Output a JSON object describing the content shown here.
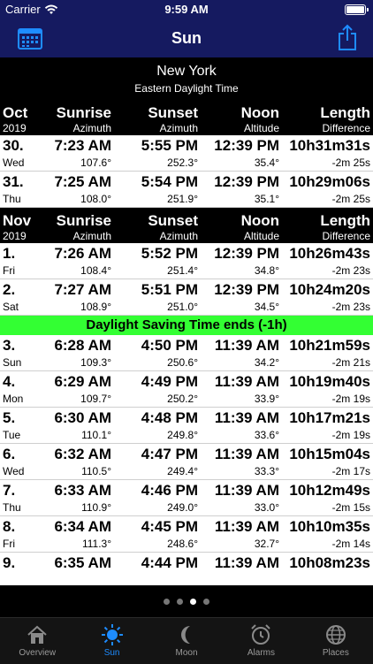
{
  "status": {
    "carrier": "Carrier",
    "time": "9:59 AM"
  },
  "nav": {
    "title": "Sun",
    "left_icon": "calendar-icon",
    "right_icon": "share-icon"
  },
  "location": {
    "city": "New York",
    "timezone": "Eastern Daylight Time"
  },
  "columns": {
    "sunrise": "Sunrise",
    "sunrise_sub": "Azimuth",
    "sunset": "Sunset",
    "sunset_sub": "Azimuth",
    "noon": "Noon",
    "noon_sub": "Altitude",
    "length": "Length",
    "length_sub": "Difference"
  },
  "oct": {
    "month": "Oct",
    "year": "2019",
    "rows": [
      {
        "day": "30.",
        "dow": "Wed",
        "sunrise": "7:23 AM",
        "sunrise_az": "107.6°",
        "sunset": "5:55 PM",
        "sunset_az": "252.3°",
        "noon": "12:39 PM",
        "noon_alt": "35.4°",
        "length": "10h31m31s",
        "diff": "-2m 25s"
      },
      {
        "day": "31.",
        "dow": "Thu",
        "sunrise": "7:25 AM",
        "sunrise_az": "108.0°",
        "sunset": "5:54 PM",
        "sunset_az": "251.9°",
        "noon": "12:39 PM",
        "noon_alt": "35.1°",
        "length": "10h29m06s",
        "diff": "-2m 25s"
      }
    ]
  },
  "nov": {
    "month": "Nov",
    "year": "2019",
    "rows_before": [
      {
        "day": "1.",
        "dow": "Fri",
        "sunrise": "7:26 AM",
        "sunrise_az": "108.4°",
        "sunset": "5:52 PM",
        "sunset_az": "251.4°",
        "noon": "12:39 PM",
        "noon_alt": "34.8°",
        "length": "10h26m43s",
        "diff": "-2m 23s"
      },
      {
        "day": "2.",
        "dow": "Sat",
        "sunrise": "7:27 AM",
        "sunrise_az": "108.9°",
        "sunset": "5:51 PM",
        "sunset_az": "251.0°",
        "noon": "12:39 PM",
        "noon_alt": "34.5°",
        "length": "10h24m20s",
        "diff": "-2m 23s"
      }
    ],
    "dst_notice": "Daylight Saving Time ends (-1h)",
    "rows_after": [
      {
        "day": "3.",
        "dow": "Sun",
        "sunrise": "6:28 AM",
        "sunrise_az": "109.3°",
        "sunset": "4:50 PM",
        "sunset_az": "250.6°",
        "noon": "11:39 AM",
        "noon_alt": "34.2°",
        "length": "10h21m59s",
        "diff": "-2m 21s"
      },
      {
        "day": "4.",
        "dow": "Mon",
        "sunrise": "6:29 AM",
        "sunrise_az": "109.7°",
        "sunset": "4:49 PM",
        "sunset_az": "250.2°",
        "noon": "11:39 AM",
        "noon_alt": "33.9°",
        "length": "10h19m40s",
        "diff": "-2m 19s"
      },
      {
        "day": "5.",
        "dow": "Tue",
        "sunrise": "6:30 AM",
        "sunrise_az": "110.1°",
        "sunset": "4:48 PM",
        "sunset_az": "249.8°",
        "noon": "11:39 AM",
        "noon_alt": "33.6°",
        "length": "10h17m21s",
        "diff": "-2m 19s"
      },
      {
        "day": "6.",
        "dow": "Wed",
        "sunrise": "6:32 AM",
        "sunrise_az": "110.5°",
        "sunset": "4:47 PM",
        "sunset_az": "249.4°",
        "noon": "11:39 AM",
        "noon_alt": "33.3°",
        "length": "10h15m04s",
        "diff": "-2m 17s"
      },
      {
        "day": "7.",
        "dow": "Thu",
        "sunrise": "6:33 AM",
        "sunrise_az": "110.9°",
        "sunset": "4:46 PM",
        "sunset_az": "249.0°",
        "noon": "11:39 AM",
        "noon_alt": "33.0°",
        "length": "10h12m49s",
        "diff": "-2m 15s"
      },
      {
        "day": "8.",
        "dow": "Fri",
        "sunrise": "6:34 AM",
        "sunrise_az": "111.3°",
        "sunset": "4:45 PM",
        "sunset_az": "248.6°",
        "noon": "11:39 AM",
        "noon_alt": "32.7°",
        "length": "10h10m35s",
        "diff": "-2m 14s"
      },
      {
        "day": "9.",
        "dow": "",
        "sunrise": "6:35 AM",
        "sunrise_az": "",
        "sunset": "4:44 PM",
        "sunset_az": "",
        "noon": "11:39 AM",
        "noon_alt": "",
        "length": "10h08m23s",
        "diff": ""
      }
    ]
  },
  "pager": {
    "count": 4,
    "active": 2
  },
  "tabs": [
    {
      "label": "Overview",
      "icon": "house-icon"
    },
    {
      "label": "Sun",
      "icon": "sun-icon"
    },
    {
      "label": "Moon",
      "icon": "moon-icon"
    },
    {
      "label": "Alarms",
      "icon": "alarm-clock-icon"
    },
    {
      "label": "Places",
      "icon": "globe-icon"
    }
  ],
  "colors": {
    "nav_bg": "#151a60",
    "dst_bg": "#33ff33",
    "active_tab": "#1e8cff"
  }
}
